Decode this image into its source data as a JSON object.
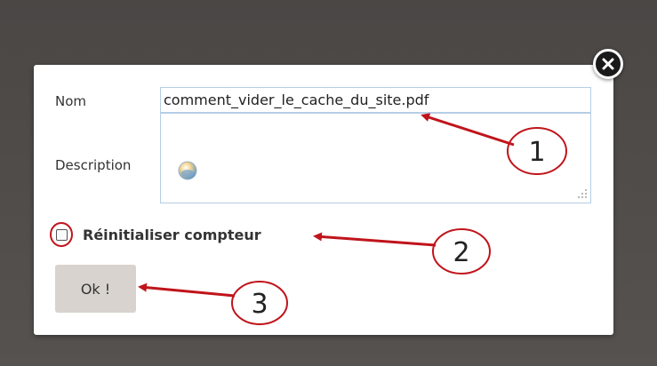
{
  "dialog": {
    "name_label": "Nom",
    "name_value": "comment_vider_le_cache_du_site.pdf",
    "description_label": "Description",
    "description_value": "",
    "reset_counter_label": "Réinitialiser compteur",
    "reset_counter_checked": false,
    "ok_label": "Ok !"
  },
  "annotations": {
    "callouts": [
      "1",
      "2",
      "3"
    ],
    "color": "#c0141b"
  },
  "colors": {
    "backdrop": "#4f4c4a",
    "dialog": "#ffffff",
    "input_border": "#b6cde6",
    "button": "#d8d3ce"
  },
  "icons": [
    "close-icon",
    "spellcheck-icon",
    "resize-grip-icon"
  ]
}
